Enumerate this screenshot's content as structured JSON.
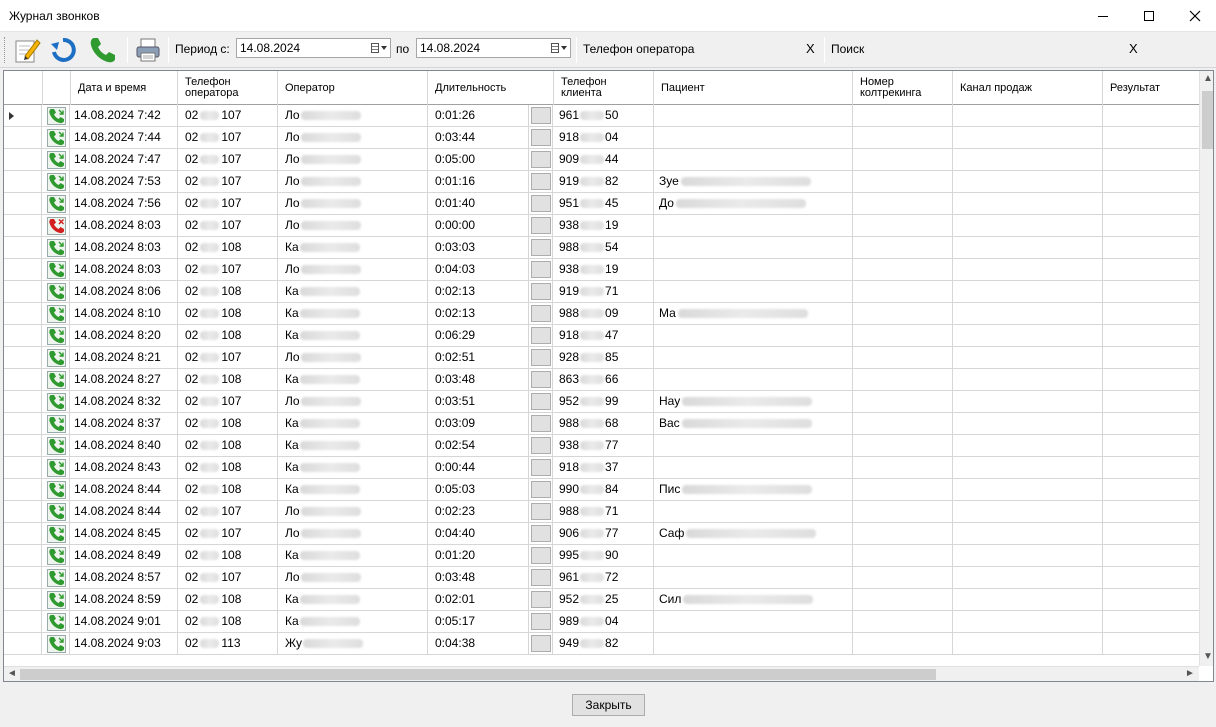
{
  "window": {
    "title": "Журнал звонков"
  },
  "toolbar": {
    "period_from_label": "Период с:",
    "date_from": "14.08.2024",
    "period_to_label": "по",
    "date_to": "14.08.2024",
    "operator_phone_label": "Телефон оператора",
    "operator_phone_value": "",
    "clear_label": "X",
    "search_label": "Поиск",
    "search_value": ""
  },
  "grid": {
    "columns": {
      "datetime": "Дата и время",
      "operator_phone": "Телефон оператора",
      "operator": "Оператор",
      "duration": "Длительность",
      "client_phone": "Телефон клиента",
      "patient": "Пациент",
      "tracking": "Номер колтрекинга",
      "channel": "Канал продаж",
      "result": "Результат"
    },
    "rows": [
      {
        "icon": "call-accepted-icon",
        "dt": "14.08.2024 7:42",
        "op_pre": "02",
        "op_suf": "107",
        "oper": "Ло",
        "dur": "0:01:26",
        "cl_pre": "961",
        "cl_suf": "50",
        "pat": ""
      },
      {
        "icon": "call-accepted-icon",
        "dt": "14.08.2024 7:44",
        "op_pre": "02",
        "op_suf": "107",
        "oper": "Ло",
        "dur": "0:03:44",
        "cl_pre": "918",
        "cl_suf": "04",
        "pat": ""
      },
      {
        "icon": "call-accepted-icon",
        "dt": "14.08.2024 7:47",
        "op_pre": "02",
        "op_suf": "107",
        "oper": "Ло",
        "dur": "0:05:00",
        "cl_pre": "909",
        "cl_suf": "44",
        "pat": ""
      },
      {
        "icon": "call-accepted-icon",
        "dt": "14.08.2024 7:53",
        "op_pre": "02",
        "op_suf": "107",
        "oper": "Ло",
        "dur": "0:01:16",
        "cl_pre": "919",
        "cl_suf": "82",
        "pat": "Зуе"
      },
      {
        "icon": "call-accepted-icon",
        "dt": "14.08.2024 7:56",
        "op_pre": "02",
        "op_suf": "107",
        "oper": "Ло",
        "dur": "0:01:40",
        "cl_pre": "951",
        "cl_suf": "45",
        "pat": "До"
      },
      {
        "icon": "call-missed-icon",
        "dt": "14.08.2024 8:03",
        "op_pre": "02",
        "op_suf": "107",
        "oper": "Ло",
        "dur": "0:00:00",
        "cl_pre": "938",
        "cl_suf": "19",
        "pat": ""
      },
      {
        "icon": "call-accepted-icon",
        "dt": "14.08.2024 8:03",
        "op_pre": "02",
        "op_suf": "108",
        "oper": "Ка",
        "dur": "0:03:03",
        "cl_pre": "988",
        "cl_suf": "54",
        "pat": ""
      },
      {
        "icon": "call-accepted-icon",
        "dt": "14.08.2024 8:03",
        "op_pre": "02",
        "op_suf": "107",
        "oper": "Ло",
        "dur": "0:04:03",
        "cl_pre": "938",
        "cl_suf": "19",
        "pat": ""
      },
      {
        "icon": "call-accepted-icon",
        "dt": "14.08.2024 8:06",
        "op_pre": "02",
        "op_suf": "108",
        "oper": "Ка",
        "dur": "0:02:13",
        "cl_pre": "919",
        "cl_suf": "71",
        "pat": ""
      },
      {
        "icon": "call-accepted-icon",
        "dt": "14.08.2024 8:10",
        "op_pre": "02",
        "op_suf": "108",
        "oper": "Ка",
        "dur": "0:02:13",
        "cl_pre": "988",
        "cl_suf": "09",
        "pat": "Ма"
      },
      {
        "icon": "call-accepted-icon",
        "dt": "14.08.2024 8:20",
        "op_pre": "02",
        "op_suf": "108",
        "oper": "Ка",
        "dur": "0:06:29",
        "cl_pre": "918",
        "cl_suf": "47",
        "pat": ""
      },
      {
        "icon": "call-accepted-icon",
        "dt": "14.08.2024 8:21",
        "op_pre": "02",
        "op_suf": "107",
        "oper": "Ло",
        "dur": "0:02:51",
        "cl_pre": "928",
        "cl_suf": "85",
        "pat": ""
      },
      {
        "icon": "call-accepted-icon",
        "dt": "14.08.2024 8:27",
        "op_pre": "02",
        "op_suf": "108",
        "oper": "Ка",
        "dur": "0:03:48",
        "cl_pre": "863",
        "cl_suf": "66",
        "pat": ""
      },
      {
        "icon": "call-accepted-icon",
        "dt": "14.08.2024 8:32",
        "op_pre": "02",
        "op_suf": "107",
        "oper": "Ло",
        "dur": "0:03:51",
        "cl_pre": "952",
        "cl_suf": "99",
        "pat": "Нау"
      },
      {
        "icon": "call-accepted-icon",
        "dt": "14.08.2024 8:37",
        "op_pre": "02",
        "op_suf": "108",
        "oper": "Ка",
        "dur": "0:03:09",
        "cl_pre": "988",
        "cl_suf": "68",
        "pat": "Вас"
      },
      {
        "icon": "call-accepted-icon",
        "dt": "14.08.2024 8:40",
        "op_pre": "02",
        "op_suf": "108",
        "oper": "Ка",
        "dur": "0:02:54",
        "cl_pre": "938",
        "cl_suf": "77",
        "pat": ""
      },
      {
        "icon": "call-accepted-icon",
        "dt": "14.08.2024 8:43",
        "op_pre": "02",
        "op_suf": "108",
        "oper": "Ка",
        "dur": "0:00:44",
        "cl_pre": "918",
        "cl_suf": "37",
        "pat": ""
      },
      {
        "icon": "call-accepted-icon",
        "dt": "14.08.2024 8:44",
        "op_pre": "02",
        "op_suf": "108",
        "oper": "Ка",
        "dur": "0:05:03",
        "cl_pre": "990",
        "cl_suf": "84",
        "pat": "Пис"
      },
      {
        "icon": "call-accepted-icon",
        "dt": "14.08.2024 8:44",
        "op_pre": "02",
        "op_suf": "107",
        "oper": "Ло",
        "dur": "0:02:23",
        "cl_pre": "988",
        "cl_suf": "71",
        "pat": ""
      },
      {
        "icon": "call-accepted-icon",
        "dt": "14.08.2024 8:45",
        "op_pre": "02",
        "op_suf": "107",
        "oper": "Ло",
        "dur": "0:04:40",
        "cl_pre": "906",
        "cl_suf": "77",
        "pat": "Саф"
      },
      {
        "icon": "call-accepted-icon",
        "dt": "14.08.2024 8:49",
        "op_pre": "02",
        "op_suf": "108",
        "oper": "Ка",
        "dur": "0:01:20",
        "cl_pre": "995",
        "cl_suf": "90",
        "pat": ""
      },
      {
        "icon": "call-accepted-icon",
        "dt": "14.08.2024 8:57",
        "op_pre": "02",
        "op_suf": "107",
        "oper": "Ло",
        "dur": "0:03:48",
        "cl_pre": "961",
        "cl_suf": "72",
        "pat": ""
      },
      {
        "icon": "call-accepted-icon",
        "dt": "14.08.2024 8:59",
        "op_pre": "02",
        "op_suf": "108",
        "oper": "Ка",
        "dur": "0:02:01",
        "cl_pre": "952",
        "cl_suf": "25",
        "pat": "Сил"
      },
      {
        "icon": "call-accepted-icon",
        "dt": "14.08.2024 9:01",
        "op_pre": "02",
        "op_suf": "108",
        "oper": "Ка",
        "dur": "0:05:17",
        "cl_pre": "989",
        "cl_suf": "04",
        "pat": ""
      },
      {
        "icon": "call-accepted-icon",
        "dt": "14.08.2024 9:03",
        "op_pre": "02",
        "op_suf": "113",
        "oper": "Жу",
        "dur": "0:04:38",
        "cl_pre": "949",
        "cl_suf": "82",
        "pat": ""
      }
    ]
  },
  "footer": {
    "close_label": "Закрыть"
  },
  "colors": {
    "accepted": "#2f9a2f",
    "missed": "#d21f1f",
    "refresh": "#1d6fc4"
  }
}
